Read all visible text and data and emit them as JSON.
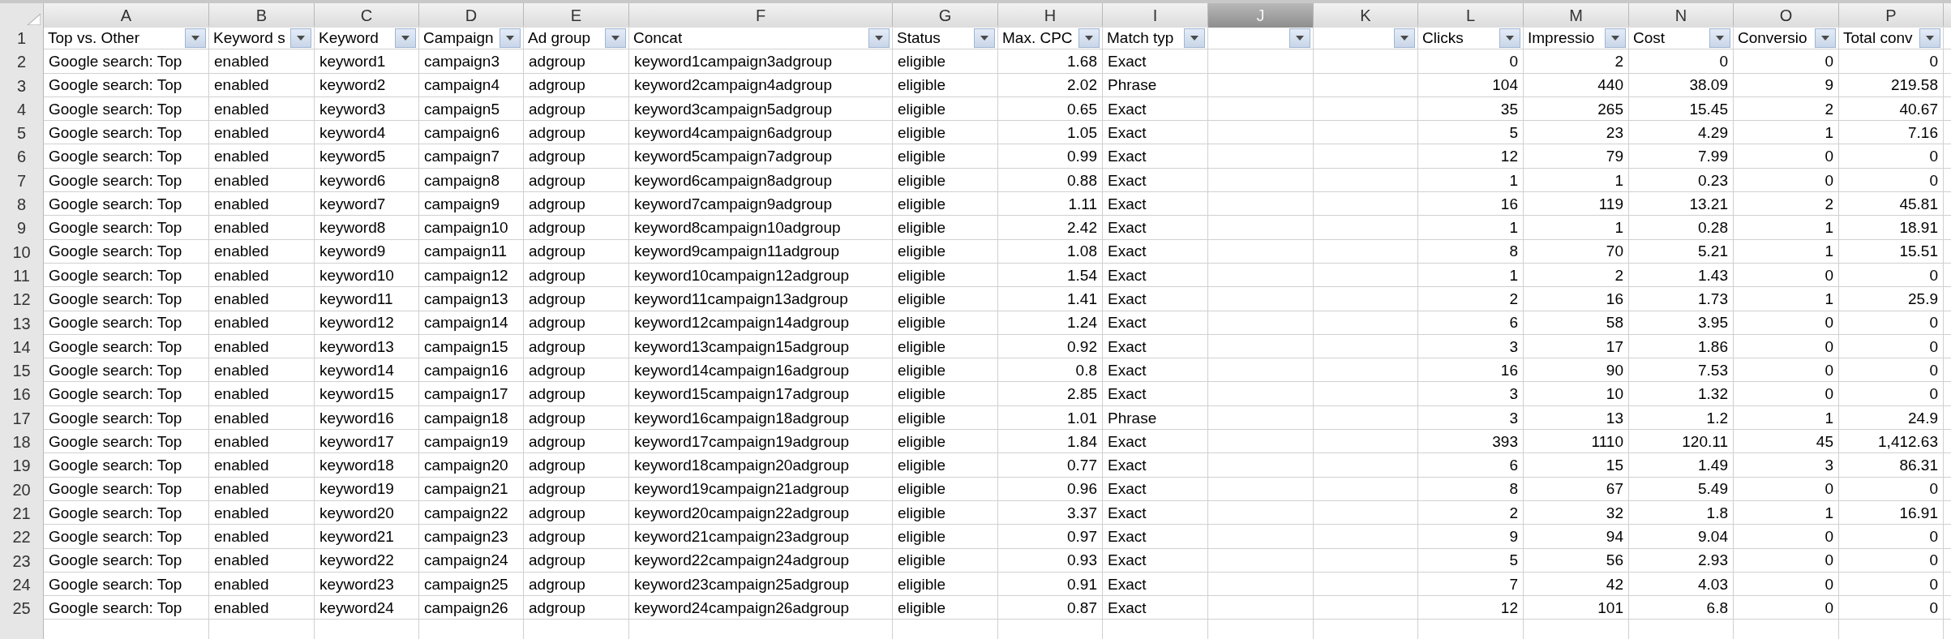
{
  "columns": [
    {
      "letter": "A",
      "selected": false,
      "header": "Top vs. Other",
      "filter": true,
      "kind": "text"
    },
    {
      "letter": "B",
      "selected": false,
      "header": "Keyword s",
      "filter": true,
      "kind": "text"
    },
    {
      "letter": "C",
      "selected": false,
      "header": "Keyword",
      "filter": true,
      "kind": "text"
    },
    {
      "letter": "D",
      "selected": false,
      "header": "Campaign",
      "filter": true,
      "kind": "text"
    },
    {
      "letter": "E",
      "selected": false,
      "header": "Ad group",
      "filter": true,
      "kind": "text"
    },
    {
      "letter": "F",
      "selected": false,
      "header": "Concat",
      "filter": true,
      "kind": "text"
    },
    {
      "letter": "G",
      "selected": false,
      "header": "Status",
      "filter": true,
      "kind": "text"
    },
    {
      "letter": "H",
      "selected": false,
      "header": "Max. CPC",
      "filter": true,
      "kind": "number"
    },
    {
      "letter": "I",
      "selected": false,
      "header": "Match typ",
      "filter": true,
      "kind": "text"
    },
    {
      "letter": "J",
      "selected": true,
      "filter": true,
      "kind": "empty"
    },
    {
      "letter": "K",
      "selected": false,
      "filter": true,
      "kind": "empty"
    },
    {
      "letter": "L",
      "selected": false,
      "header": "Clicks",
      "filter": true,
      "kind": "number"
    },
    {
      "letter": "M",
      "selected": false,
      "header": "Impressio",
      "filter": true,
      "kind": "number"
    },
    {
      "letter": "N",
      "selected": false,
      "header": "Cost",
      "filter": true,
      "kind": "number"
    },
    {
      "letter": "O",
      "selected": false,
      "header": "Conversio",
      "filter": true,
      "kind": "number"
    },
    {
      "letter": "P",
      "selected": false,
      "header": "Total conv",
      "filter": true,
      "kind": "number"
    }
  ],
  "header_row_number": "1",
  "rows": [
    {
      "number": "2",
      "cells": [
        "Google search: Top",
        "enabled",
        "keyword1",
        "campaign3",
        "adgroup",
        "keyword1campaign3adgroup",
        "eligible",
        "1.68",
        "Exact",
        "0",
        "2",
        "0",
        "0",
        "0"
      ]
    },
    {
      "number": "3",
      "cells": [
        "Google search: Top",
        "enabled",
        "keyword2",
        "campaign4",
        "adgroup",
        "keyword2campaign4adgroup",
        "eligible",
        "2.02",
        "Phrase",
        "104",
        "440",
        "38.09",
        "9",
        "219.58"
      ]
    },
    {
      "number": "4",
      "cells": [
        "Google search: Top",
        "enabled",
        "keyword3",
        "campaign5",
        "adgroup",
        "keyword3campaign5adgroup",
        "eligible",
        "0.65",
        "Exact",
        "35",
        "265",
        "15.45",
        "2",
        "40.67"
      ]
    },
    {
      "number": "5",
      "cells": [
        "Google search: Top",
        "enabled",
        "keyword4",
        "campaign6",
        "adgroup",
        "keyword4campaign6adgroup",
        "eligible",
        "1.05",
        "Exact",
        "5",
        "23",
        "4.29",
        "1",
        "7.16"
      ]
    },
    {
      "number": "6",
      "cells": [
        "Google search: Top",
        "enabled",
        "keyword5",
        "campaign7",
        "adgroup",
        "keyword5campaign7adgroup",
        "eligible",
        "0.99",
        "Exact",
        "12",
        "79",
        "7.99",
        "0",
        "0"
      ]
    },
    {
      "number": "7",
      "cells": [
        "Google search: Top",
        "enabled",
        "keyword6",
        "campaign8",
        "adgroup",
        "keyword6campaign8adgroup",
        "eligible",
        "0.88",
        "Exact",
        "1",
        "1",
        "0.23",
        "0",
        "0"
      ]
    },
    {
      "number": "8",
      "cells": [
        "Google search: Top",
        "enabled",
        "keyword7",
        "campaign9",
        "adgroup",
        "keyword7campaign9adgroup",
        "eligible",
        "1.11",
        "Exact",
        "16",
        "119",
        "13.21",
        "2",
        "45.81"
      ]
    },
    {
      "number": "9",
      "cells": [
        "Google search: Top",
        "enabled",
        "keyword8",
        "campaign10",
        "adgroup",
        "keyword8campaign10adgroup",
        "eligible",
        "2.42",
        "Exact",
        "1",
        "1",
        "0.28",
        "1",
        "18.91"
      ]
    },
    {
      "number": "10",
      "cells": [
        "Google search: Top",
        "enabled",
        "keyword9",
        "campaign11",
        "adgroup",
        "keyword9campaign11adgroup",
        "eligible",
        "1.08",
        "Exact",
        "8",
        "70",
        "5.21",
        "1",
        "15.51"
      ]
    },
    {
      "number": "11",
      "cells": [
        "Google search: Top",
        "enabled",
        "keyword10",
        "campaign12",
        "adgroup",
        "keyword10campaign12adgroup",
        "eligible",
        "1.54",
        "Exact",
        "1",
        "2",
        "1.43",
        "0",
        "0"
      ]
    },
    {
      "number": "12",
      "cells": [
        "Google search: Top",
        "enabled",
        "keyword11",
        "campaign13",
        "adgroup",
        "keyword11campaign13adgroup",
        "eligible",
        "1.41",
        "Exact",
        "2",
        "16",
        "1.73",
        "1",
        "25.9"
      ]
    },
    {
      "number": "13",
      "cells": [
        "Google search: Top",
        "enabled",
        "keyword12",
        "campaign14",
        "adgroup",
        "keyword12campaign14adgroup",
        "eligible",
        "1.24",
        "Exact",
        "6",
        "58",
        "3.95",
        "0",
        "0"
      ]
    },
    {
      "number": "14",
      "cells": [
        "Google search: Top",
        "enabled",
        "keyword13",
        "campaign15",
        "adgroup",
        "keyword13campaign15adgroup",
        "eligible",
        "0.92",
        "Exact",
        "3",
        "17",
        "1.86",
        "0",
        "0"
      ]
    },
    {
      "number": "15",
      "cells": [
        "Google search: Top",
        "enabled",
        "keyword14",
        "campaign16",
        "adgroup",
        "keyword14campaign16adgroup",
        "eligible",
        "0.8",
        "Exact",
        "16",
        "90",
        "7.53",
        "0",
        "0"
      ]
    },
    {
      "number": "16",
      "cells": [
        "Google search: Top",
        "enabled",
        "keyword15",
        "campaign17",
        "adgroup",
        "keyword15campaign17adgroup",
        "eligible",
        "2.85",
        "Exact",
        "3",
        "10",
        "1.32",
        "0",
        "0"
      ]
    },
    {
      "number": "17",
      "cells": [
        "Google search: Top",
        "enabled",
        "keyword16",
        "campaign18",
        "adgroup",
        "keyword16campaign18adgroup",
        "eligible",
        "1.01",
        "Phrase",
        "3",
        "13",
        "1.2",
        "1",
        "24.9"
      ]
    },
    {
      "number": "18",
      "cells": [
        "Google search: Top",
        "enabled",
        "keyword17",
        "campaign19",
        "adgroup",
        "keyword17campaign19adgroup",
        "eligible",
        "1.84",
        "Exact",
        "393",
        "1110",
        "120.11",
        "45",
        "1,412.63"
      ]
    },
    {
      "number": "19",
      "cells": [
        "Google search: Top",
        "enabled",
        "keyword18",
        "campaign20",
        "adgroup",
        "keyword18campaign20adgroup",
        "eligible",
        "0.77",
        "Exact",
        "6",
        "15",
        "1.49",
        "3",
        "86.31"
      ]
    },
    {
      "number": "20",
      "cells": [
        "Google search: Top",
        "enabled",
        "keyword19",
        "campaign21",
        "adgroup",
        "keyword19campaign21adgroup",
        "eligible",
        "0.96",
        "Exact",
        "8",
        "67",
        "5.49",
        "0",
        "0"
      ]
    },
    {
      "number": "21",
      "cells": [
        "Google search: Top",
        "enabled",
        "keyword20",
        "campaign22",
        "adgroup",
        "keyword20campaign22adgroup",
        "eligible",
        "3.37",
        "Exact",
        "2",
        "32",
        "1.8",
        "1",
        "16.91"
      ]
    },
    {
      "number": "22",
      "cells": [
        "Google search: Top",
        "enabled",
        "keyword21",
        "campaign23",
        "adgroup",
        "keyword21campaign23adgroup",
        "eligible",
        "0.97",
        "Exact",
        "9",
        "94",
        "9.04",
        "0",
        "0"
      ]
    },
    {
      "number": "23",
      "cells": [
        "Google search: Top",
        "enabled",
        "keyword22",
        "campaign24",
        "adgroup",
        "keyword22campaign24adgroup",
        "eligible",
        "0.93",
        "Exact",
        "5",
        "56",
        "2.93",
        "0",
        "0"
      ]
    },
    {
      "number": "24",
      "cells": [
        "Google search: Top",
        "enabled",
        "keyword23",
        "campaign25",
        "adgroup",
        "keyword23campaign25adgroup",
        "eligible",
        "0.91",
        "Exact",
        "7",
        "42",
        "4.03",
        "0",
        "0"
      ]
    },
    {
      "number": "25",
      "cells": [
        "Google search: Top",
        "enabled",
        "keyword24",
        "campaign26",
        "adgroup",
        "keyword24campaign26adgroup",
        "eligible",
        "0.87",
        "Exact",
        "12",
        "101",
        "6.8",
        "0",
        "0"
      ]
    }
  ]
}
